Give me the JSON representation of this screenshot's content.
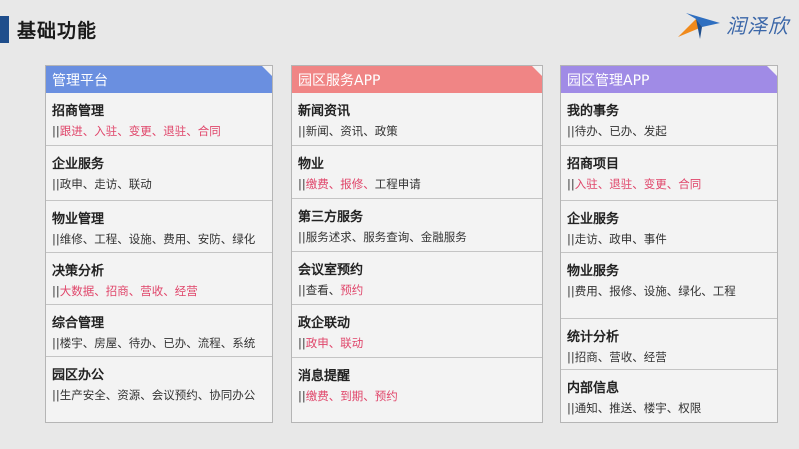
{
  "header": {
    "title": "基础功能"
  },
  "logo": {
    "text": "润泽欣"
  },
  "colors": {
    "title_accent": "#1f4e8c",
    "col1_head": "#6a8fe0",
    "col2_head": "#f08585",
    "col3_head": "#a08be6",
    "highlight_text": "#e0456a"
  },
  "columns": [
    {
      "title": "管理平台",
      "items": [
        {
          "title": "招商管理",
          "desc": "||跟进、入驻、变更、退驻、合同",
          "highlight": true
        },
        {
          "title": "企业服务",
          "desc": "||政申、走访、联动",
          "highlight": false
        },
        {
          "title": "物业管理",
          "desc": "||维修、工程、设施、费用、安防、绿化",
          "highlight": false
        },
        {
          "title": "决策分析",
          "desc": "||大数据、招商、营收、经营",
          "highlight": true
        },
        {
          "title": "综合管理",
          "desc": "||楼宇、房屋、待办、已办、流程、系统",
          "highlight": false
        },
        {
          "title": "园区办公",
          "desc": "||生产安全、资源、会议预约、协同办公",
          "highlight": false
        }
      ]
    },
    {
      "title": "园区服务APP",
      "items": [
        {
          "title": "新闻资讯",
          "desc": "||新闻、资讯、政策",
          "highlight": false
        },
        {
          "title": "物业",
          "desc": "||缴费、报修、工程申请",
          "highlight": "partial",
          "red": "缴费、报修、",
          "rest": "工程申请"
        },
        {
          "title": "第三方服务",
          "desc": "||服务述求、服务查询、金融服务",
          "highlight": false
        },
        {
          "title": "会议室预约",
          "desc": "||查看、预约",
          "highlight": "partial",
          "red": "预约",
          "rest": "",
          "pre": "查看、"
        },
        {
          "title": "政企联动",
          "desc": "||政申、联动",
          "highlight": true
        },
        {
          "title": "消息提醒",
          "desc": "||缴费、到期、预约",
          "highlight": true
        }
      ]
    },
    {
      "title": "园区管理APP",
      "items": [
        {
          "title": "我的事务",
          "desc": "||待办、已办、发起",
          "highlight": false
        },
        {
          "title": "招商项目",
          "desc": "||入驻、退驻、变更、合同",
          "highlight": true
        },
        {
          "title": "企业服务",
          "desc": "||走访、政申、事件",
          "highlight": false
        },
        {
          "title": "物业服务",
          "desc": "||费用、报修、设施、绿化、工程",
          "highlight": false
        },
        {
          "title": "统计分析",
          "desc": "||招商、营收、经营",
          "highlight": false
        },
        {
          "title": "内部信息",
          "desc": "||通知、推送、楼宇、权限",
          "highlight": false
        }
      ]
    }
  ]
}
